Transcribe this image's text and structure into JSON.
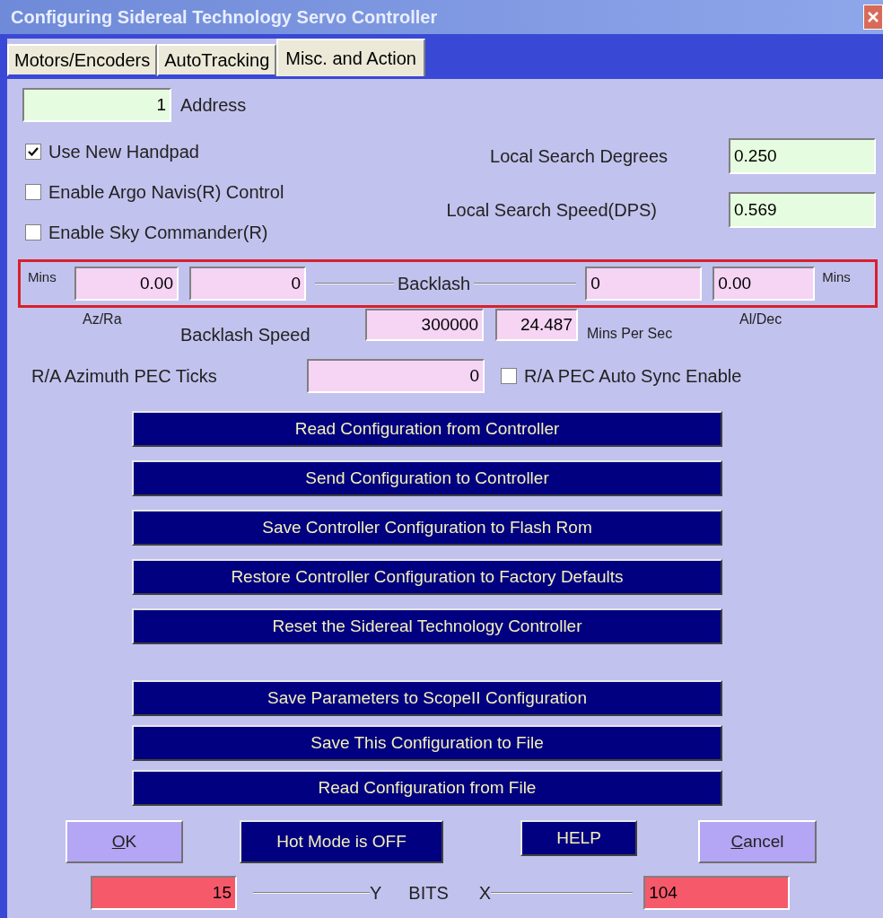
{
  "window": {
    "title": "Configuring Sidereal Technology Servo Controller"
  },
  "tabs": [
    {
      "label": "Motors/Encoders",
      "selected": false
    },
    {
      "label": "AutoTracking",
      "selected": false
    },
    {
      "label": "Misc. and Action",
      "selected": true
    }
  ],
  "address": {
    "value": "1",
    "label": "Address"
  },
  "options": [
    {
      "label": "Use New Handpad",
      "checked": true
    },
    {
      "label": "Enable Argo Navis(R) Control",
      "checked": false
    },
    {
      "label": "Enable Sky Commander(R)",
      "checked": false
    }
  ],
  "local_search": [
    {
      "label": "Local Search Degrees",
      "value": "0.250"
    },
    {
      "label": "Local Search Speed(DPS)",
      "value": "0.569"
    }
  ],
  "backlash": {
    "left_unit": "Mins",
    "az_mins": "0.00",
    "az_ticks": "0",
    "title": "Backlash",
    "alt_ticks": "0",
    "alt_mins": "0.00",
    "right_unit": "Mins",
    "az_label": "Az/Ra",
    "alt_label": "Al/Dec"
  },
  "backlash_speed": {
    "label": "Backlash Speed",
    "ticks": "300000",
    "mins": "24.487",
    "unit": "Mins Per Sec"
  },
  "pec": {
    "label": "R/A Azimuth PEC Ticks",
    "value": "0",
    "auto_sync": {
      "label": "R/A PEC Auto Sync Enable",
      "checked": false
    }
  },
  "action_groups": [
    [
      "Read Configuration from Controller",
      "Send Configuration to Controller",
      "Save Controller Configuration to Flash Rom",
      "Restore Controller Configuration to Factory Defaults",
      "Reset the Sidereal Technology Controller"
    ],
    [
      "Save Parameters to ScopeII Configuration",
      "Save This Configuration to File",
      "Read Configuration from File"
    ]
  ],
  "bottom_buttons": [
    {
      "kind": "dialog",
      "label": "OK"
    },
    {
      "kind": "state",
      "label": "Hot Mode is OFF"
    },
    {
      "kind": "state",
      "label": "HELP"
    },
    {
      "kind": "dialog",
      "label": "Cancel"
    }
  ],
  "bits": {
    "y_value": "15",
    "y_label": "Y",
    "title": "BITS",
    "x_label": "X",
    "x_value": "104"
  }
}
